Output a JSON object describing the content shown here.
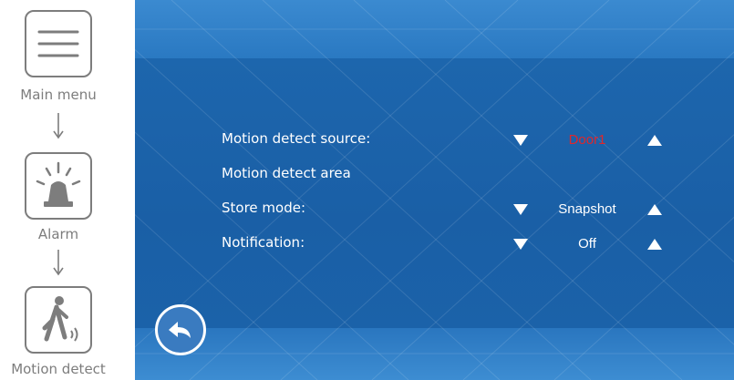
{
  "breadcrumb": {
    "steps": [
      {
        "label": "Main menu",
        "icon": "menu-icon"
      },
      {
        "label": "Alarm",
        "icon": "alarm-siren-icon"
      },
      {
        "label": "Motion detect",
        "icon": "walking-person-icon"
      }
    ]
  },
  "settings": {
    "rows": [
      {
        "label": "Motion detect source:",
        "value": "Door1",
        "value_color": "#e0262b"
      },
      {
        "label": "Motion detect area"
      },
      {
        "label": "Store mode:",
        "value": "Snapshot",
        "value_color": "#ffffff"
      },
      {
        "label": "Notification:",
        "value": "Off",
        "value_color": "#ffffff"
      }
    ]
  },
  "icons": {
    "decrease": "triangle-down-icon",
    "increase": "triangle-up-icon",
    "back": "back-arrow-icon"
  },
  "colors": {
    "screen_background": "#1a5fa6",
    "highlight_value": "#e0262b",
    "text": "#ffffff",
    "nav_gray": "#7d7d7d"
  }
}
